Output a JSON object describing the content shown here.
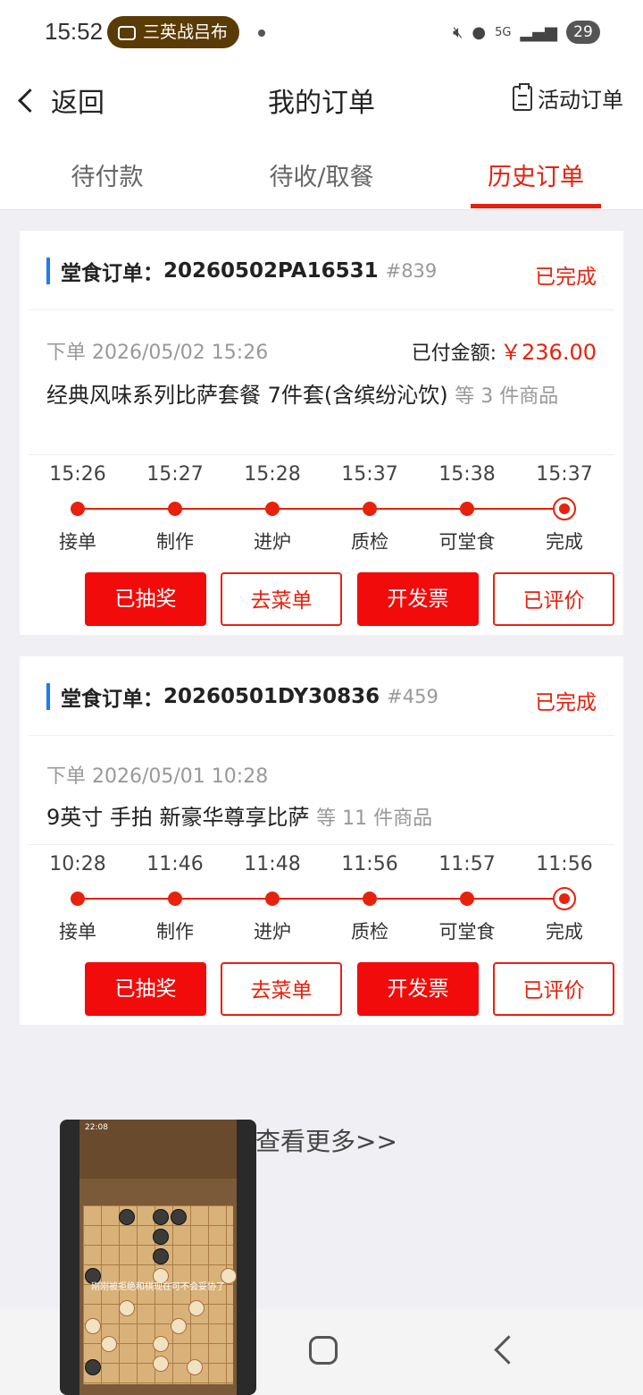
{
  "status_bar": {
    "time": "15:52",
    "pill_text": "三英战吕布",
    "battery": "29",
    "net": "5G"
  },
  "header": {
    "back_label": "返回",
    "title": "我的订单",
    "activity_label": "活动订单"
  },
  "tabs": [
    {
      "label": "待付款"
    },
    {
      "label": "待收/取餐"
    },
    {
      "label": "历史订单"
    }
  ],
  "orders": [
    {
      "type_label": "堂食订单：",
      "order_no": "20260502PA16531",
      "num": "#839",
      "status": "已完成",
      "order_time": "下单 2026/05/02 15:26",
      "paid_label": "已付金额:",
      "paid_amount": "￥236.00",
      "item_name": "经典风味系列比萨套餐 7件套(含缤纷沁饮)",
      "item_more": "等 3 件商品",
      "timeline": [
        {
          "time": "15:26",
          "label": "接单"
        },
        {
          "time": "15:27",
          "label": "制作"
        },
        {
          "time": "15:28",
          "label": "进炉"
        },
        {
          "time": "15:37",
          "label": "质检"
        },
        {
          "time": "15:38",
          "label": "可堂食"
        },
        {
          "time": "15:37",
          "label": "完成"
        }
      ],
      "buttons": [
        "已抽奖",
        "去菜单",
        "开发票",
        "已评价"
      ]
    },
    {
      "type_label": "堂食订单：",
      "order_no": "20260501DY30836",
      "num": "#459",
      "status": "已完成",
      "order_time": "下单 2026/05/01 10:28",
      "item_name": "9英寸 手拍 新豪华尊享比萨",
      "item_more": "等 11 件商品",
      "timeline": [
        {
          "time": "10:28",
          "label": "接单"
        },
        {
          "time": "11:46",
          "label": "制作"
        },
        {
          "time": "11:48",
          "label": "进炉"
        },
        {
          "time": "11:56",
          "label": "质检"
        },
        {
          "time": "11:57",
          "label": "可堂食"
        },
        {
          "time": "11:56",
          "label": "完成"
        }
      ],
      "buttons": [
        "已抽奖",
        "去菜单",
        "开发票",
        "已评价"
      ]
    }
  ],
  "more_link": "查看更多>>",
  "pip": {
    "time": "22:08",
    "caption": "刚刚被拒绝和棋现在可不会妥协了"
  },
  "colors": {
    "accent": "#e8210c",
    "button_fill": "#f20b0b",
    "order_bar": "#1e7cf2"
  }
}
